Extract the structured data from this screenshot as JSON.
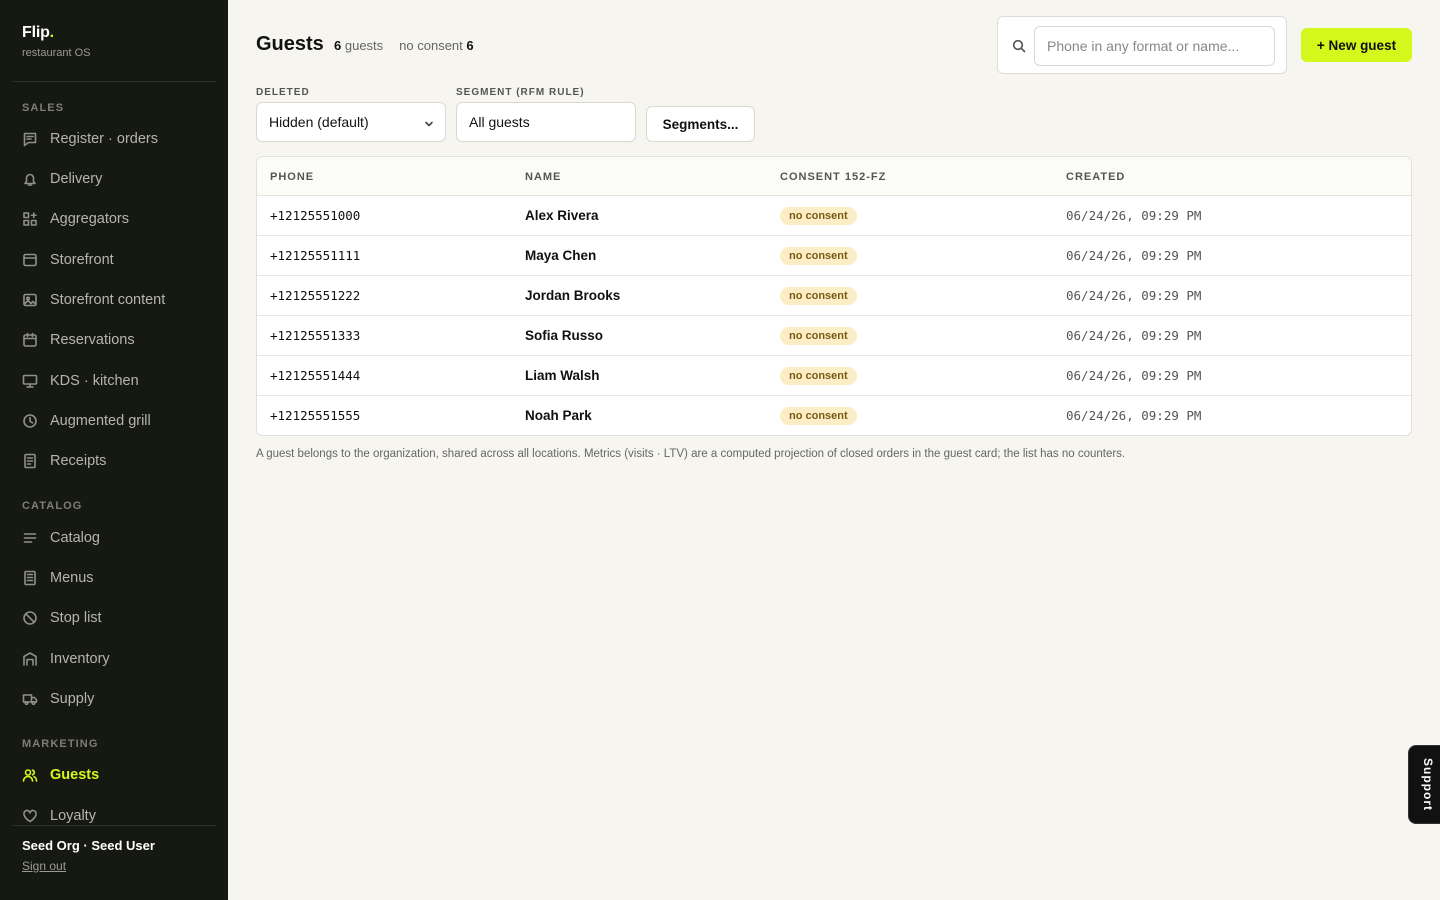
{
  "brand": {
    "name": "Flip",
    "dot": ".",
    "subtitle": "restaurant OS"
  },
  "sidebar": {
    "sections": [
      {
        "label": "SALES"
      },
      {
        "label": "CATALOG"
      },
      {
        "label": "MARKETING"
      }
    ],
    "items": [
      {
        "label": "Register · orders",
        "icon": "receipt-lines-icon"
      },
      {
        "label": "Delivery",
        "icon": "bell-icon"
      },
      {
        "label": "Aggregators",
        "icon": "grid-plus-icon"
      },
      {
        "label": "Storefront",
        "icon": "window-icon"
      },
      {
        "label": "Storefront content",
        "icon": "image-icon"
      },
      {
        "label": "Reservations",
        "icon": "calendar-icon"
      },
      {
        "label": "KDS · kitchen",
        "icon": "monitor-icon"
      },
      {
        "label": "Augmented grill",
        "icon": "clock-icon"
      },
      {
        "label": "Receipts",
        "icon": "document-icon"
      },
      {
        "label": "Catalog",
        "icon": "list-icon"
      },
      {
        "label": "Menus",
        "icon": "menu-book-icon"
      },
      {
        "label": "Stop list",
        "icon": "ban-icon"
      },
      {
        "label": "Inventory",
        "icon": "warehouse-icon"
      },
      {
        "label": "Supply",
        "icon": "truck-icon"
      },
      {
        "label": "Guests",
        "icon": "users-icon",
        "active": true
      },
      {
        "label": "Loyalty",
        "icon": "heart-icon"
      }
    ],
    "user": "Seed Org · Seed User",
    "signout": "Sign out"
  },
  "header": {
    "title": "Guests",
    "guest_count": "6",
    "guest_count_label": "guests",
    "no_consent_label": "no consent",
    "no_consent_count": "6",
    "search_placeholder": "Phone in any format or name...",
    "new_guest_label": "+ New guest"
  },
  "filters": {
    "deleted_label": "DELETED",
    "deleted_value": "Hidden (default)",
    "segment_label": "SEGMENT (RFM RULE)",
    "segment_value": "All guests",
    "segments_button": "Segments..."
  },
  "table": {
    "columns": [
      "PHONE",
      "NAME",
      "CONSENT 152-FZ",
      "CREATED"
    ],
    "rows": [
      {
        "phone": "+12125551000",
        "name": "Alex Rivera",
        "consent": "no consent",
        "created": "06/24/26, 09:29 PM"
      },
      {
        "phone": "+12125551111",
        "name": "Maya Chen",
        "consent": "no consent",
        "created": "06/24/26, 09:29 PM"
      },
      {
        "phone": "+12125551222",
        "name": "Jordan Brooks",
        "consent": "no consent",
        "created": "06/24/26, 09:29 PM"
      },
      {
        "phone": "+12125551333",
        "name": "Sofia Russo",
        "consent": "no consent",
        "created": "06/24/26, 09:29 PM"
      },
      {
        "phone": "+12125551444",
        "name": "Liam Walsh",
        "consent": "no consent",
        "created": "06/24/26, 09:29 PM"
      },
      {
        "phone": "+12125551555",
        "name": "Noah Park",
        "consent": "no consent",
        "created": "06/24/26, 09:29 PM"
      }
    ]
  },
  "footnote": "A guest belongs to the organization, shared across all locations. Metrics (visits · LTV) are a computed projection of closed orders in the guest card; the list has no counters.",
  "support_label": "Support",
  "colors": {
    "accent": "#d4f71c",
    "sidebar_bg": "#161812",
    "page_bg": "#f6f5f0",
    "badge_bg": "#fbedc5"
  }
}
